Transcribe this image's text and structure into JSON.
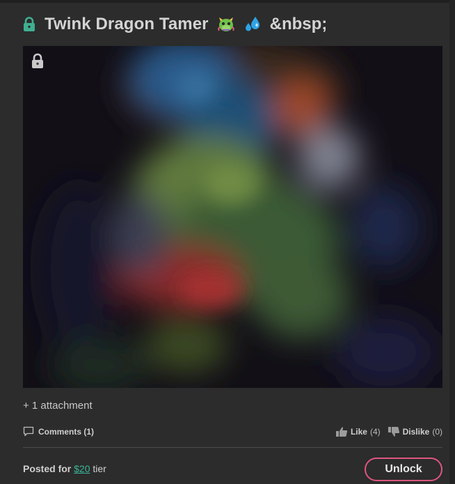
{
  "post": {
    "title": "Twink Dragon Tamer",
    "title_suffix": "&nbsp;",
    "title_lock_icon": "lock-icon",
    "title_lock_color": "#3fae91",
    "emojis": [
      "dragon-face",
      "sweat-droplets"
    ],
    "media": {
      "lock_icon": "lock-icon",
      "blurred": true
    },
    "attachment_text": "+ 1 attachment",
    "comments_label": "Comments (1)",
    "like_label": "Like",
    "like_count": "(4)",
    "dislike_label": "Dislike",
    "dislike_count": "(0)",
    "posted_prefix": "Posted for",
    "tier_price": "$20",
    "tier_suffix": "tier",
    "unlock_label": "Unlock"
  },
  "colors": {
    "background": "#2b2c2b",
    "accent_link": "#3bb59a",
    "unlock_border": "#e0557f"
  }
}
